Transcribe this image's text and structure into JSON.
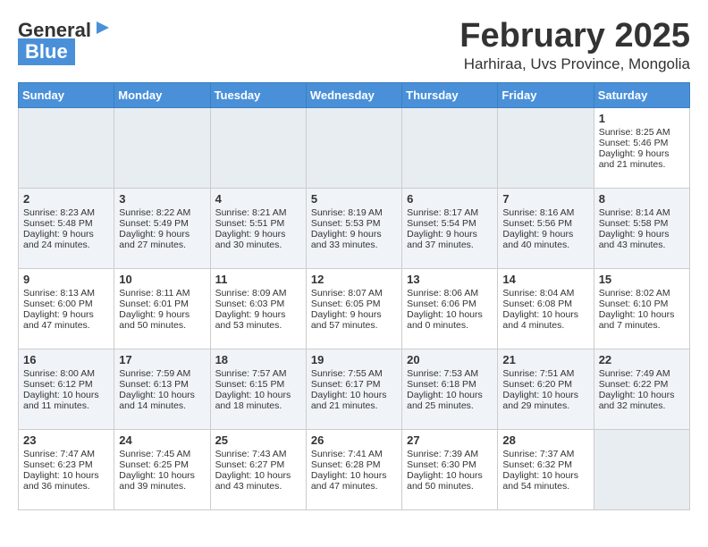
{
  "header": {
    "logo_general": "General",
    "logo_blue": "Blue",
    "month": "February 2025",
    "location": "Harhiraa, Uvs Province, Mongolia"
  },
  "weekdays": [
    "Sunday",
    "Monday",
    "Tuesday",
    "Wednesday",
    "Thursday",
    "Friday",
    "Saturday"
  ],
  "rows": [
    [
      {
        "day": "",
        "text": ""
      },
      {
        "day": "",
        "text": ""
      },
      {
        "day": "",
        "text": ""
      },
      {
        "day": "",
        "text": ""
      },
      {
        "day": "",
        "text": ""
      },
      {
        "day": "",
        "text": ""
      },
      {
        "day": "1",
        "text": "Sunrise: 8:25 AM\nSunset: 5:46 PM\nDaylight: 9 hours and 21 minutes."
      }
    ],
    [
      {
        "day": "2",
        "text": "Sunrise: 8:23 AM\nSunset: 5:48 PM\nDaylight: 9 hours and 24 minutes."
      },
      {
        "day": "3",
        "text": "Sunrise: 8:22 AM\nSunset: 5:49 PM\nDaylight: 9 hours and 27 minutes."
      },
      {
        "day": "4",
        "text": "Sunrise: 8:21 AM\nSunset: 5:51 PM\nDaylight: 9 hours and 30 minutes."
      },
      {
        "day": "5",
        "text": "Sunrise: 8:19 AM\nSunset: 5:53 PM\nDaylight: 9 hours and 33 minutes."
      },
      {
        "day": "6",
        "text": "Sunrise: 8:17 AM\nSunset: 5:54 PM\nDaylight: 9 hours and 37 minutes."
      },
      {
        "day": "7",
        "text": "Sunrise: 8:16 AM\nSunset: 5:56 PM\nDaylight: 9 hours and 40 minutes."
      },
      {
        "day": "8",
        "text": "Sunrise: 8:14 AM\nSunset: 5:58 PM\nDaylight: 9 hours and 43 minutes."
      }
    ],
    [
      {
        "day": "9",
        "text": "Sunrise: 8:13 AM\nSunset: 6:00 PM\nDaylight: 9 hours and 47 minutes."
      },
      {
        "day": "10",
        "text": "Sunrise: 8:11 AM\nSunset: 6:01 PM\nDaylight: 9 hours and 50 minutes."
      },
      {
        "day": "11",
        "text": "Sunrise: 8:09 AM\nSunset: 6:03 PM\nDaylight: 9 hours and 53 minutes."
      },
      {
        "day": "12",
        "text": "Sunrise: 8:07 AM\nSunset: 6:05 PM\nDaylight: 9 hours and 57 minutes."
      },
      {
        "day": "13",
        "text": "Sunrise: 8:06 AM\nSunset: 6:06 PM\nDaylight: 10 hours and 0 minutes."
      },
      {
        "day": "14",
        "text": "Sunrise: 8:04 AM\nSunset: 6:08 PM\nDaylight: 10 hours and 4 minutes."
      },
      {
        "day": "15",
        "text": "Sunrise: 8:02 AM\nSunset: 6:10 PM\nDaylight: 10 hours and 7 minutes."
      }
    ],
    [
      {
        "day": "16",
        "text": "Sunrise: 8:00 AM\nSunset: 6:12 PM\nDaylight: 10 hours and 11 minutes."
      },
      {
        "day": "17",
        "text": "Sunrise: 7:59 AM\nSunset: 6:13 PM\nDaylight: 10 hours and 14 minutes."
      },
      {
        "day": "18",
        "text": "Sunrise: 7:57 AM\nSunset: 6:15 PM\nDaylight: 10 hours and 18 minutes."
      },
      {
        "day": "19",
        "text": "Sunrise: 7:55 AM\nSunset: 6:17 PM\nDaylight: 10 hours and 21 minutes."
      },
      {
        "day": "20",
        "text": "Sunrise: 7:53 AM\nSunset: 6:18 PM\nDaylight: 10 hours and 25 minutes."
      },
      {
        "day": "21",
        "text": "Sunrise: 7:51 AM\nSunset: 6:20 PM\nDaylight: 10 hours and 29 minutes."
      },
      {
        "day": "22",
        "text": "Sunrise: 7:49 AM\nSunset: 6:22 PM\nDaylight: 10 hours and 32 minutes."
      }
    ],
    [
      {
        "day": "23",
        "text": "Sunrise: 7:47 AM\nSunset: 6:23 PM\nDaylight: 10 hours and 36 minutes."
      },
      {
        "day": "24",
        "text": "Sunrise: 7:45 AM\nSunset: 6:25 PM\nDaylight: 10 hours and 39 minutes."
      },
      {
        "day": "25",
        "text": "Sunrise: 7:43 AM\nSunset: 6:27 PM\nDaylight: 10 hours and 43 minutes."
      },
      {
        "day": "26",
        "text": "Sunrise: 7:41 AM\nSunset: 6:28 PM\nDaylight: 10 hours and 47 minutes."
      },
      {
        "day": "27",
        "text": "Sunrise: 7:39 AM\nSunset: 6:30 PM\nDaylight: 10 hours and 50 minutes."
      },
      {
        "day": "28",
        "text": "Sunrise: 7:37 AM\nSunset: 6:32 PM\nDaylight: 10 hours and 54 minutes."
      },
      {
        "day": "",
        "text": ""
      }
    ]
  ]
}
